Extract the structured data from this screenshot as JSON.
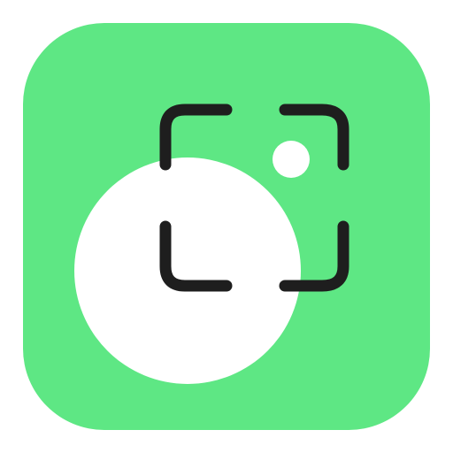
{
  "app_icon": {
    "name": "screen-capture-app-icon",
    "colors": {
      "background": "#5EE784",
      "foreground_circle": "#FFFFFF",
      "frame_stroke": "#1E1E1E",
      "small_dot": "#FFFFFF"
    },
    "glyphs": [
      "rounded-square-background",
      "large-circle",
      "small-dot",
      "capture-frame-corners"
    ]
  }
}
